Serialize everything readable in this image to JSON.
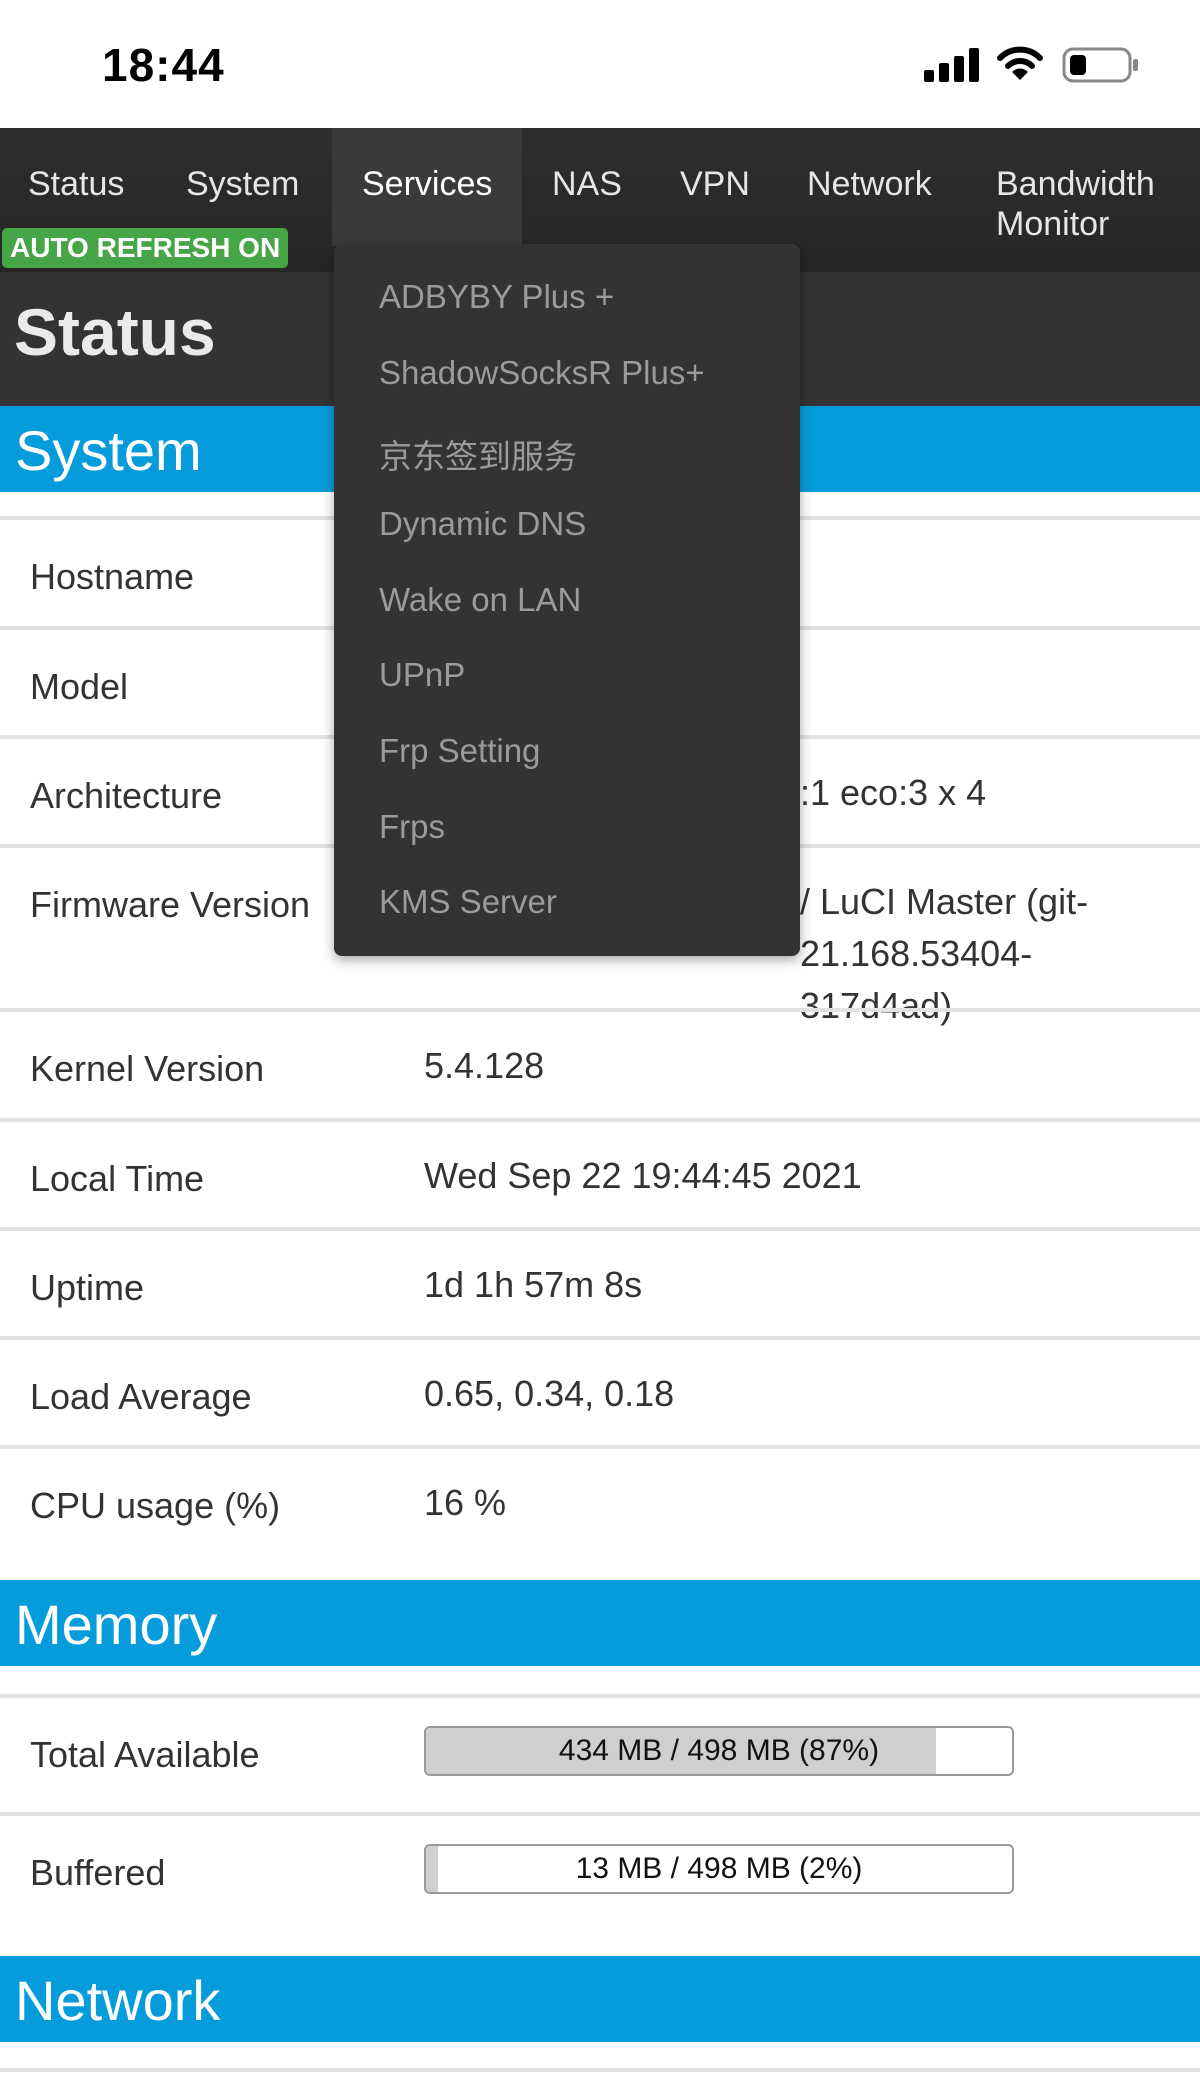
{
  "status_bar": {
    "time": "18:44",
    "icons": [
      "signal-icon",
      "wifi-icon",
      "battery-icon"
    ]
  },
  "nav": {
    "items": [
      {
        "label": "Status"
      },
      {
        "label": "System"
      },
      {
        "label": "Services",
        "active": true
      },
      {
        "label": "NAS"
      },
      {
        "label": "VPN"
      },
      {
        "label": "Network"
      },
      {
        "label": "Bandwidth Monitor"
      }
    ],
    "auto_refresh": "AUTO REFRESH ON"
  },
  "page": {
    "title": "Status"
  },
  "services_menu": {
    "items": [
      "ADBYBY Plus +",
      "ShadowSocksR Plus+",
      "京东签到服务",
      "Dynamic DNS",
      "Wake on LAN",
      "UPnP",
      "Frp Setting",
      "Frps",
      "KMS Server"
    ]
  },
  "system": {
    "heading": "System",
    "rows": [
      {
        "label": "Hostname",
        "value": ""
      },
      {
        "label": "Model",
        "value": ""
      },
      {
        "label": "Architecture",
        "value": ":1 eco:3 x 4"
      },
      {
        "label": "Firmware Version",
        "value": "/ LuCI Master (git-21.168.53404-317d4ad)"
      },
      {
        "label": "Kernel Version",
        "value": "5.4.128"
      },
      {
        "label": "Local Time",
        "value": "Wed Sep 22 19:44:45 2021"
      },
      {
        "label": "Uptime",
        "value": "1d 1h 57m 8s"
      },
      {
        "label": "Load Average",
        "value": "0.65, 0.34, 0.18"
      },
      {
        "label": "CPU usage (%)",
        "value": "16 %"
      }
    ]
  },
  "memory": {
    "heading": "Memory",
    "rows": [
      {
        "label": "Total Available",
        "text": "434 MB / 498 MB (87%)",
        "fraction": 0.87
      },
      {
        "label": "Buffered",
        "text": "13 MB / 498 MB (2%)",
        "fraction": 0.02
      }
    ]
  },
  "network": {
    "heading": "Network"
  },
  "colors": {
    "nav_bg": "#2e2e2e",
    "section_header": "#069cdb",
    "auto_refresh": "#46a546",
    "menu_bg": "#333333"
  }
}
